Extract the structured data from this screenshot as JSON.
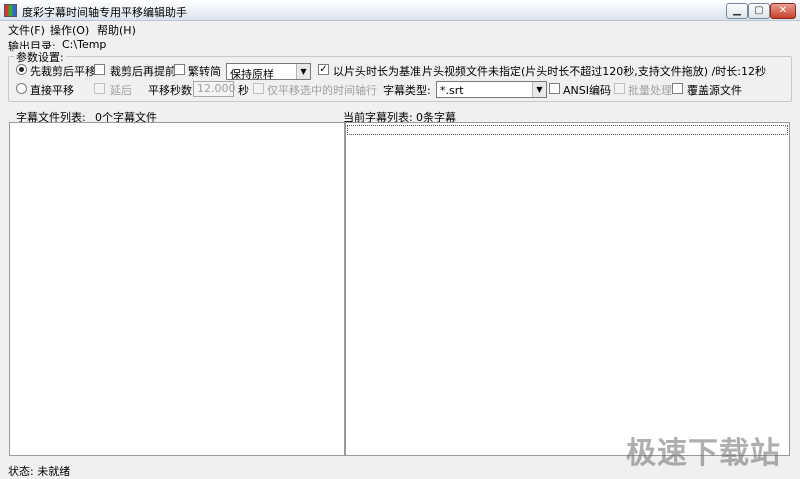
{
  "window": {
    "title": "度彩字幕时间轴专用平移编辑助手",
    "buttons": {
      "minimize": "▁",
      "maximize": "▢",
      "close": "✕"
    }
  },
  "menu": [
    "文件(F)",
    "操作(O)",
    "帮助(H)"
  ],
  "output": {
    "label": "输出目录:",
    "path": "C:\\Temp"
  },
  "params": {
    "legend": "参数设置:",
    "radio_cut_then_shift": "先裁剪后平移",
    "chk_cut_advance": "裁剪后再提前",
    "chk_trad_simp": "繁转简",
    "combo_keep": "保持原样",
    "chk_opening_base": "以片头时长为基准",
    "opening_info": "片头视频文件未指定(片头时长不超过120秒,支持文件拖放)  /时长:12秒",
    "radio_direct_shift": "直接平移",
    "chk_delay": "延后",
    "shift_seconds_label": "平移秒数:",
    "shift_seconds_value": "12.000",
    "seconds_unit": "秒",
    "chk_only_selected": "仅平移选中的时间轴行",
    "subtitle_type_label": "字幕类型:",
    "subtitle_type_value": "*.srt",
    "chk_ansi": "ANSI编码",
    "chk_batch": "批量处理",
    "chk_overwrite": "覆盖源文件"
  },
  "lists": {
    "left_header": "字幕文件列表:",
    "left_count": "0个字幕文件",
    "right_header": "当前字幕列表:",
    "right_count": "0条字幕"
  },
  "status": {
    "text": "状态: 未就绪"
  },
  "watermark": "极速下载站",
  "icons": {
    "arrow": "▼",
    "check": "✓"
  }
}
